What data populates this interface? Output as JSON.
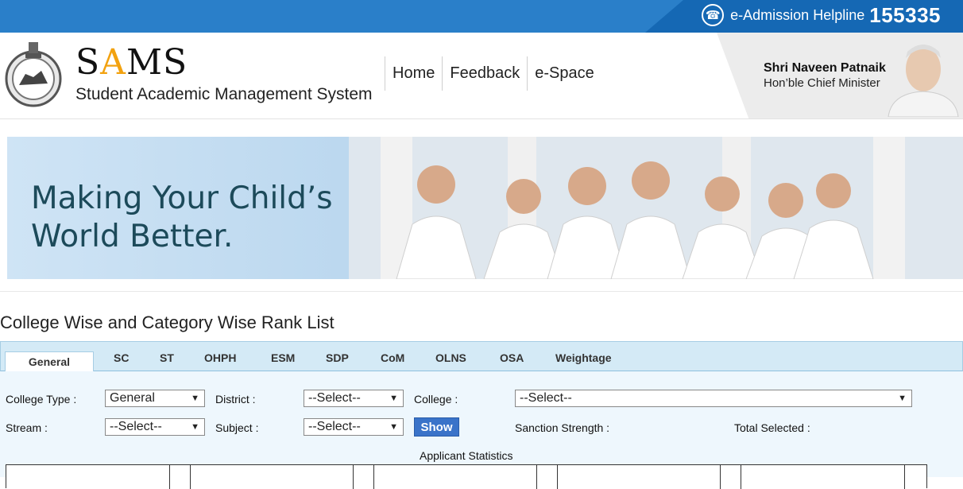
{
  "helpline": {
    "label": "e-Admission Helpline",
    "number": "155335"
  },
  "header": {
    "logo_prefix": "S",
    "logo_accent": "A",
    "logo_suffix": "MS",
    "logo_sub": "Student Academic Management System",
    "nav": [
      "Home",
      "Feedback",
      "e-Space"
    ],
    "cm_name": "Shri Naveen Patnaik",
    "cm_title": "Hon’ble Chief Minister"
  },
  "banner": {
    "line1": "Making Your Child’s",
    "line2": "World Better."
  },
  "page_title": "College Wise and Category Wise Rank List",
  "tabs": [
    "General",
    "SC",
    "ST",
    "OHPH",
    "ESM",
    "SDP",
    "CoM",
    "OLNS",
    "OSA",
    "Weightage"
  ],
  "active_tab": "General",
  "form": {
    "college_type_label": "College Type :",
    "college_type_value": "General",
    "district_label": "District :",
    "district_value": "--Select--",
    "college_label": "College :",
    "college_value": "--Select--",
    "stream_label": "Stream :",
    "stream_value": "--Select--",
    "subject_label": "Subject :",
    "subject_value": "--Select--",
    "show_button": "Show",
    "sanction_label": "Sanction Strength :",
    "total_selected_label": "Total Selected :"
  },
  "stats": {
    "title": "Applicant Statistics"
  },
  "colors": {
    "topbar": "#2a7fc9",
    "tabbar": "#d4eaf6",
    "show_button": "#3a73c9",
    "accent": "#f2a210"
  }
}
